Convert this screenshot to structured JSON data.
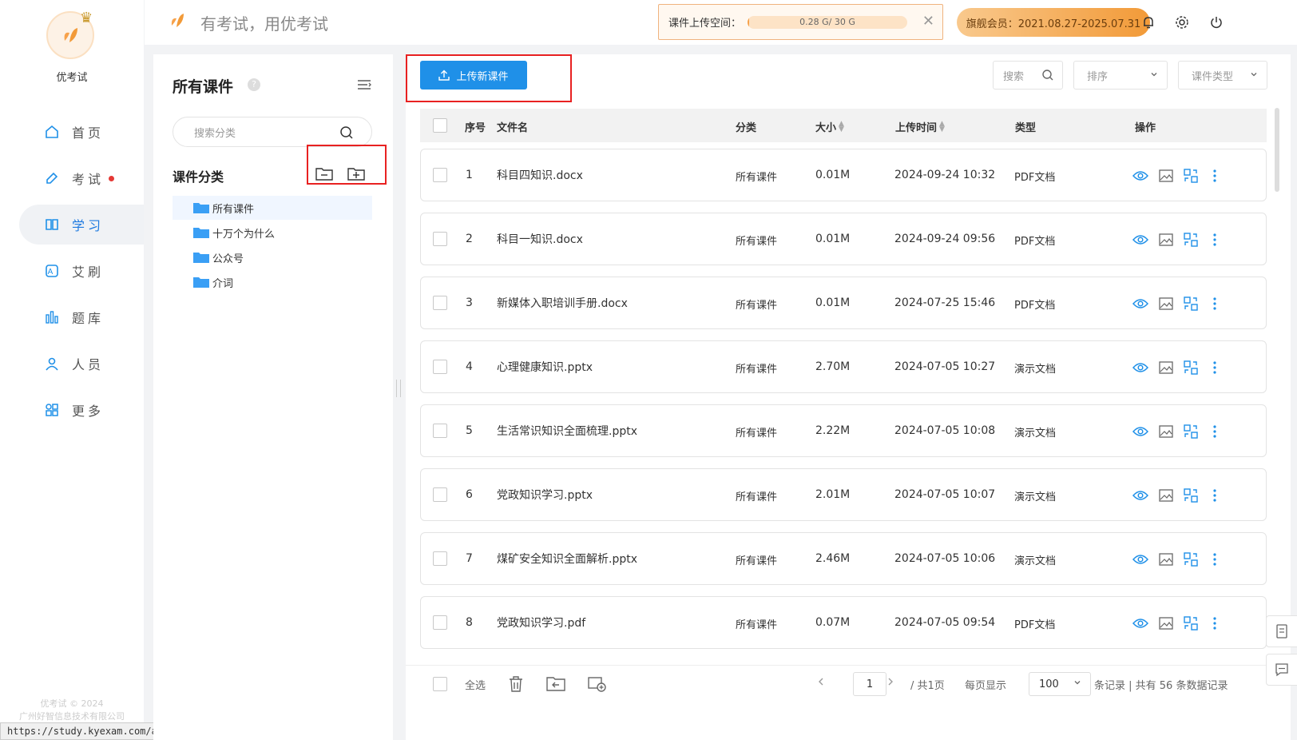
{
  "app": {
    "name": "优考试",
    "slogan": "有考试，用优考试",
    "copyright_line1": "优考试 © 2024",
    "copyright_line2": "广州好智信息技术有限公司",
    "status_url": "https://study.kyexam.com/admin#"
  },
  "nav": [
    {
      "label": "首页",
      "icon": "home-icon",
      "active": false
    },
    {
      "label": "考试",
      "icon": "pen-icon",
      "active": false,
      "dot": true
    },
    {
      "label": "学习",
      "icon": "book-icon",
      "active": true
    },
    {
      "label": "艾刷",
      "icon": "a-badge-icon",
      "active": false
    },
    {
      "label": "题库",
      "icon": "bars-icon",
      "active": false
    },
    {
      "label": "人员",
      "icon": "user-icon",
      "active": false
    },
    {
      "label": "更多",
      "icon": "apps-icon",
      "active": false
    }
  ],
  "header": {
    "storage_label": "课件上传空间：",
    "storage_value": "0.28 G/ 30 G",
    "storage_fraction": 0.0093,
    "vip_text": "旗舰会员：2021.08.27-2025.07.31"
  },
  "category": {
    "title": "所有课件",
    "search_placeholder": "搜索分类",
    "section_title": "课件分类",
    "tree": [
      "所有课件",
      "十万个为什么",
      "公众号",
      "介词"
    ]
  },
  "toolbar": {
    "upload_label": "上传新课件",
    "search_label": "搜索",
    "sort_label": "排序",
    "type_label": "课件类型"
  },
  "table": {
    "headers": {
      "index": "序号",
      "name": "文件名",
      "category": "分类",
      "size": "大小",
      "time": "上传时间",
      "type": "类型",
      "ops": "操作"
    },
    "rows": [
      {
        "index": "1",
        "name": "科目四知识.docx",
        "category": "所有课件",
        "size": "0.01M",
        "time": "2024-09-24 10:32",
        "type": "PDF文档"
      },
      {
        "index": "2",
        "name": "科目一知识.docx",
        "category": "所有课件",
        "size": "0.01M",
        "time": "2024-09-24 09:56",
        "type": "PDF文档"
      },
      {
        "index": "3",
        "name": "新媒体入职培训手册.docx",
        "category": "所有课件",
        "size": "0.01M",
        "time": "2024-07-25 15:46",
        "type": "PDF文档"
      },
      {
        "index": "4",
        "name": "心理健康知识.pptx",
        "category": "所有课件",
        "size": "2.70M",
        "time": "2024-07-05 10:27",
        "type": "演示文档"
      },
      {
        "index": "5",
        "name": "生活常识知识全面梳理.pptx",
        "category": "所有课件",
        "size": "2.22M",
        "time": "2024-07-05 10:08",
        "type": "演示文档"
      },
      {
        "index": "6",
        "name": "党政知识学习.pptx",
        "category": "所有课件",
        "size": "2.01M",
        "time": "2024-07-05 10:07",
        "type": "演示文档"
      },
      {
        "index": "7",
        "name": "煤矿安全知识全面解析.pptx",
        "category": "所有课件",
        "size": "2.46M",
        "time": "2024-07-05 10:06",
        "type": "演示文档"
      },
      {
        "index": "8",
        "name": "党政知识学习.pdf",
        "category": "所有课件",
        "size": "0.07M",
        "time": "2024-07-05 09:54",
        "type": "PDF文档"
      }
    ]
  },
  "footer": {
    "select_all": "全选",
    "page_value": "1",
    "total_pages": "/ 共1页",
    "per_page_label": "每页显示",
    "per_page_value": "100",
    "records_text": "条记录 | 共有 56 条数据记录"
  },
  "colors": {
    "accent": "#1f90e8",
    "highlight_box": "#e82121",
    "vip": "#f29a38"
  }
}
